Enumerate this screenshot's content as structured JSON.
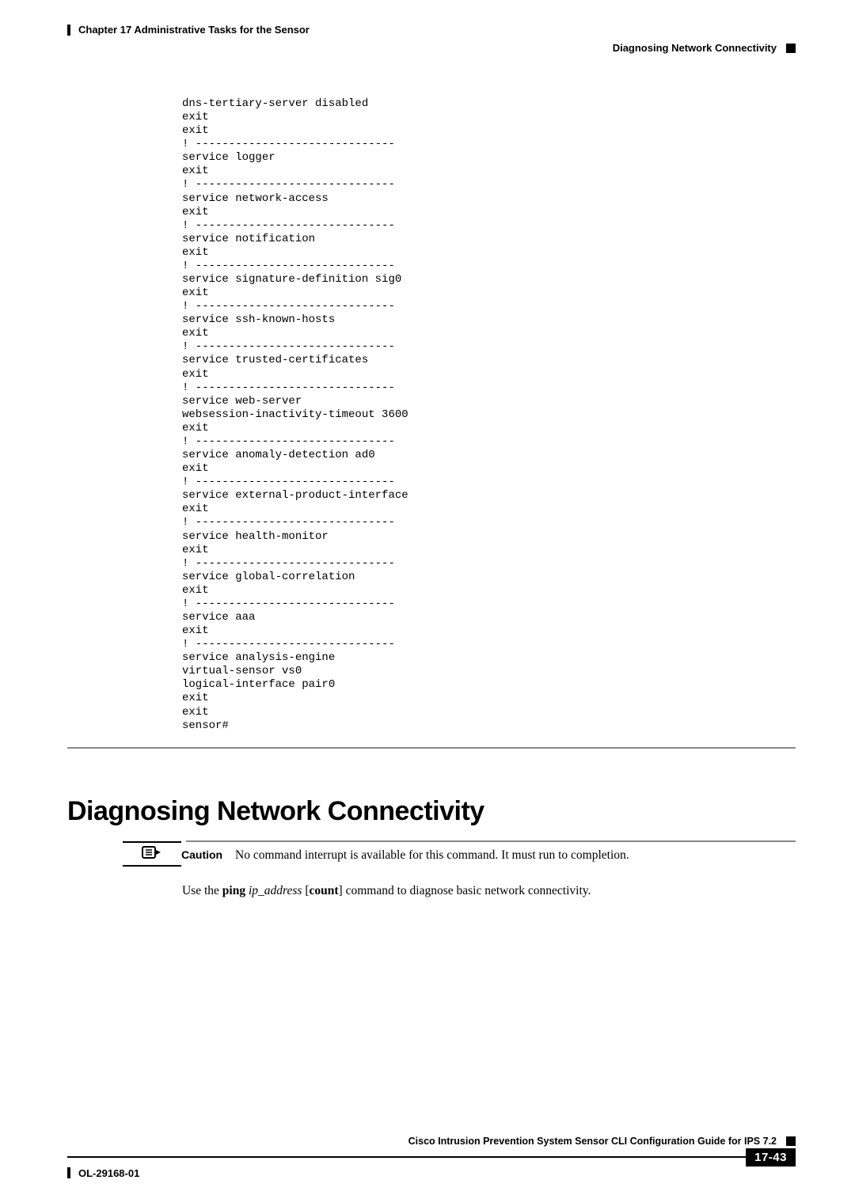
{
  "header": {
    "chapter_label": "Chapter 17    Administrative Tasks for the Sensor",
    "section_label": "Diagnosing Network Connectivity"
  },
  "code": "dns-tertiary-server disabled\nexit\nexit\n! ------------------------------\nservice logger\nexit\n! ------------------------------\nservice network-access\nexit\n! ------------------------------\nservice notification\nexit\n! ------------------------------\nservice signature-definition sig0\nexit\n! ------------------------------\nservice ssh-known-hosts\nexit\n! ------------------------------\nservice trusted-certificates\nexit\n! ------------------------------\nservice web-server\nwebsession-inactivity-timeout 3600\nexit\n! ------------------------------\nservice anomaly-detection ad0\nexit\n! ------------------------------\nservice external-product-interface\nexit\n! ------------------------------\nservice health-monitor\nexit\n! ------------------------------\nservice global-correlation\nexit\n! ------------------------------\nservice aaa\nexit\n! ------------------------------\nservice analysis-engine\nvirtual-sensor vs0\nlogical-interface pair0\nexit\nexit\nsensor#",
  "heading": "Diagnosing Network Connectivity",
  "caution": {
    "label": "Caution",
    "text": "No command interrupt is available for this command. It must run to completion."
  },
  "usage": {
    "prefix": "Use the ",
    "cmd_bold_1": "ping",
    "cmd_italic": " ip_address ",
    "bracket_open": "[",
    "cmd_bold_2": "count",
    "bracket_close": "]",
    "suffix": " command to diagnose basic network connectivity."
  },
  "footer": {
    "book_title": "Cisco Intrusion Prevention System Sensor CLI Configuration Guide for IPS 7.2",
    "doc_id": "OL-29168-01",
    "page_num": "17-43"
  }
}
